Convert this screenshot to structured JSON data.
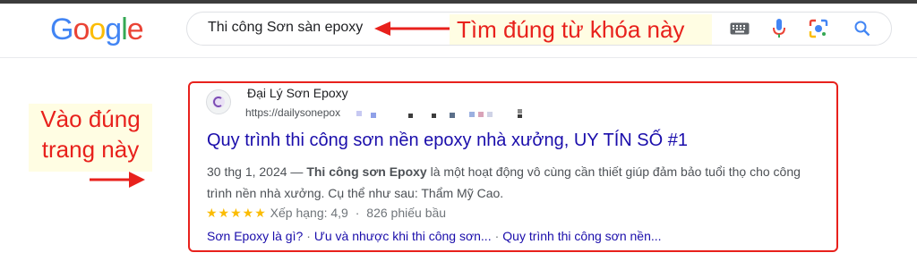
{
  "header": {
    "logo_letters": [
      {
        "ch": "G",
        "color": "#4285F4"
      },
      {
        "ch": "o",
        "color": "#EA4335"
      },
      {
        "ch": "o",
        "color": "#FBBC05"
      },
      {
        "ch": "g",
        "color": "#4285F4"
      },
      {
        "ch": "l",
        "color": "#34A853"
      },
      {
        "ch": "e",
        "color": "#EA4335"
      }
    ],
    "search_query": "Thi công Sơn sàn epoxy",
    "icons": [
      "keyboard-icon",
      "mic-icon",
      "lens-icon",
      "search-icon"
    ]
  },
  "annotations": {
    "top_note": "Tìm đúng từ khóa này",
    "left_note_line1": "Vào đúng",
    "left_note_line2": "trang này",
    "annotation_color": "#e8211c"
  },
  "result": {
    "site_name": "Đại Lý Sơn Epoxy",
    "url": "https://dailysonepox",
    "title": "Quy trình thi công sơn nền epoxy nhà xưởng, UY TÍN SỐ #1",
    "date": "30 thg 1, 2024",
    "dash": "—",
    "snippet_bold": "Thi công sơn Epoxy",
    "snippet_rest": "là một hoạt động vô cùng cần thiết giúp đảm bảo tuổi thọ cho công trình nền nhà xưởng. Cụ thể như sau: Thẩm Mỹ Cao.",
    "stars": "★★★★★",
    "rating_label": "Xếp hạng: 4,9",
    "votes": "826 phiếu bầu",
    "rating_value": 4.9,
    "sitelinks": [
      "Sơn Epoxy là gì?",
      "Ưu và nhược khi thi công sơn...",
      "Quy trình thi công sơn nền..."
    ]
  },
  "colors": {
    "link": "#1a0dab",
    "highlight_box": "#e8211c",
    "stars": "#fbbc04"
  }
}
